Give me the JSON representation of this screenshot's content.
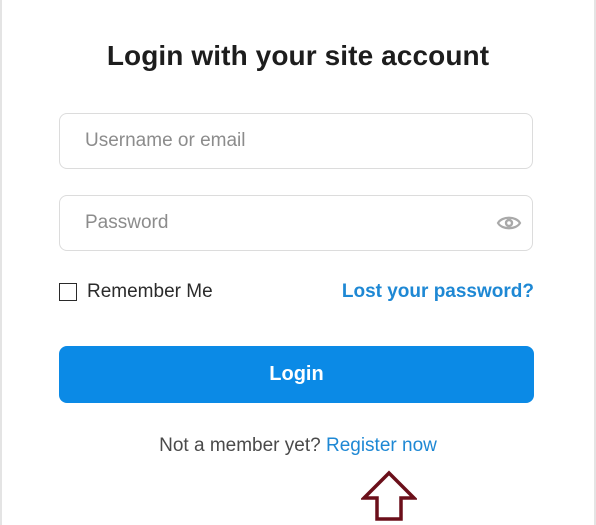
{
  "title": "Login with your site account",
  "username_field": {
    "placeholder": "Username or email",
    "value": ""
  },
  "password_field": {
    "placeholder": "Password",
    "value": "",
    "toggle_icon": "eye-icon"
  },
  "remember_me": {
    "label": "Remember Me",
    "checked": false
  },
  "lost_password_label": "Lost your password?",
  "login_button_label": "Login",
  "register": {
    "prompt": "Not a member yet?",
    "link_label": "Register now"
  },
  "annotation": {
    "icon": "up-arrow-icon",
    "color": "#6b0f1a"
  },
  "colors": {
    "accent": "#0b8ae6",
    "link": "#1e88d4"
  }
}
